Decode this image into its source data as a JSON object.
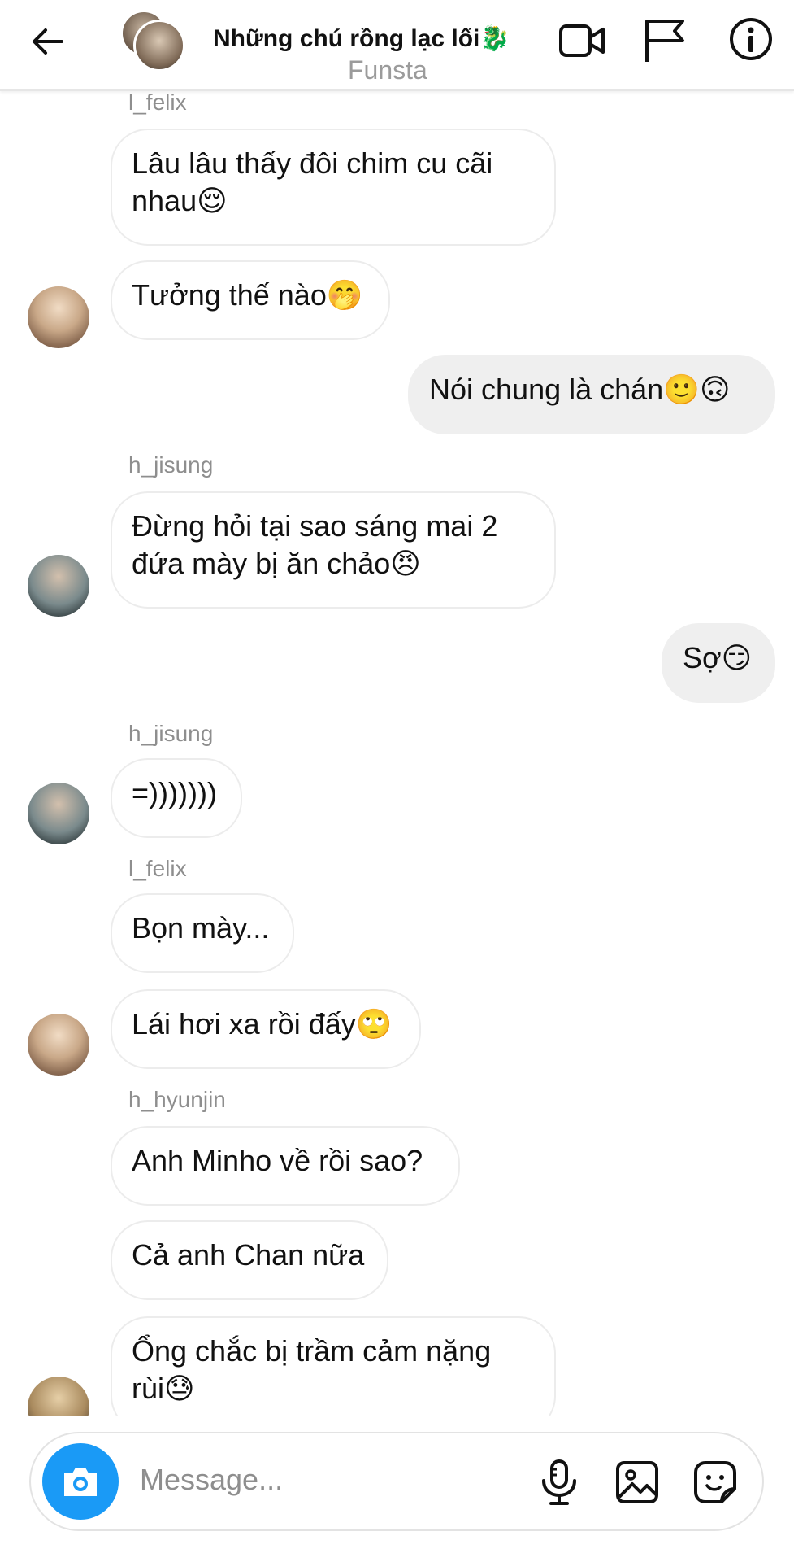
{
  "header": {
    "title": "Những chú rồng lạc lối🐉",
    "subtitle": "Funsta"
  },
  "messages": [
    {
      "sender": "l_felix",
      "text": "Lâu lâu thấy đôi chim cu cãi\nnhau😌"
    },
    {
      "text": "Tưởng thế nào🤭"
    },
    {
      "text": "Nói chung là chán🙂🙃",
      "outgoing": true
    },
    {
      "sender": "h_jisung",
      "text": "Đừng hỏi tại sao sáng mai 2\nđứa mày bị ăn chảo😠"
    },
    {
      "text": "Sợ😏",
      "outgoing": true
    },
    {
      "sender": "h_jisung",
      "text": "=)))))))"
    },
    {
      "sender": "l_felix",
      "text": "Bọn mày..."
    },
    {
      "text": "Lái hơi xa rồi đấy🙄"
    },
    {
      "sender": "h_hyunjin",
      "text": "Anh Minho về rồi sao?"
    },
    {
      "text": "Cả anh Chan nữa"
    },
    {
      "text": "Ổng chắc bị trầm cảm nặng\nrùi😓"
    }
  ],
  "composer": {
    "placeholder": "Message..."
  },
  "icons": {
    "back": "arrow-left-icon",
    "video": "video-camera-icon",
    "flag": "flag-icon",
    "info": "info-icon",
    "camera": "camera-icon",
    "mic": "microphone-icon",
    "gallery": "image-icon",
    "sticker": "sticker-icon"
  },
  "colors": {
    "accent": "#1a9af6",
    "outgoing_bubble": "#efefef",
    "muted_text": "#8e8e8e"
  }
}
